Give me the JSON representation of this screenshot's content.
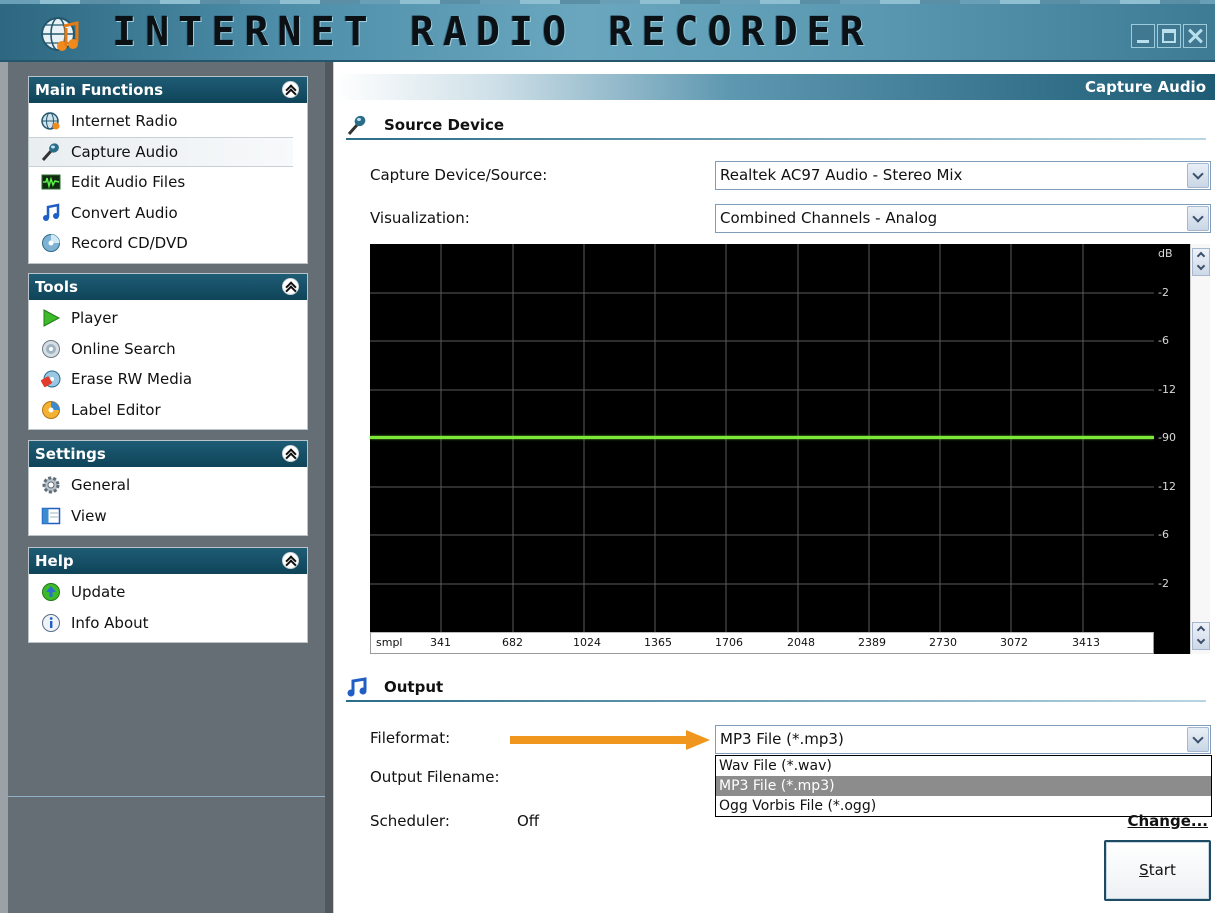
{
  "app": {
    "title": "INTERNET RADIO RECORDER"
  },
  "sidebar": {
    "panels": [
      {
        "title": "Main Functions",
        "items": [
          {
            "label": "Internet Radio",
            "icon": "radio-globe-icon"
          },
          {
            "label": "Capture Audio",
            "icon": "microphone-icon",
            "selected": true
          },
          {
            "label": "Edit Audio Files",
            "icon": "waveform-icon"
          },
          {
            "label": "Convert Audio",
            "icon": "music-notes-icon"
          },
          {
            "label": "Record CD/DVD",
            "icon": "cd-icon"
          }
        ]
      },
      {
        "title": "Tools",
        "items": [
          {
            "label": "Player",
            "icon": "play-icon"
          },
          {
            "label": "Online Search",
            "icon": "search-disc-icon"
          },
          {
            "label": "Erase RW Media",
            "icon": "erase-disc-icon"
          },
          {
            "label": "Label Editor",
            "icon": "label-disc-icon"
          }
        ]
      },
      {
        "title": "Settings",
        "items": [
          {
            "label": "General",
            "icon": "gear-icon"
          },
          {
            "label": "View",
            "icon": "view-icon"
          }
        ]
      },
      {
        "title": "Help",
        "items": [
          {
            "label": "Update",
            "icon": "update-icon"
          },
          {
            "label": "Info About",
            "icon": "info-icon"
          }
        ]
      }
    ]
  },
  "main": {
    "page_title": "Capture Audio",
    "source_section": {
      "title": "Source Device",
      "capture_label": "Capture Device/Source:",
      "capture_value": "Realtek AC97 Audio - Stereo Mix",
      "visualization_label": "Visualization:",
      "visualization_value": "Combined Channels - Analog"
    },
    "visualizer": {
      "scale_unit": "dB",
      "scale_ticks": [
        "-2",
        "-6",
        "-12",
        "-90",
        "-12",
        "-6",
        "-2"
      ],
      "x_label": "smpl",
      "x_ticks": [
        "341",
        "682",
        "1024",
        "1365",
        "1706",
        "2048",
        "2389",
        "2730",
        "3072",
        "3413"
      ],
      "signal_color": "#7ee83a"
    },
    "output_section": {
      "title": "Output",
      "fileformat_label": "Fileformat:",
      "fileformat_value": "MP3 File (*.mp3)",
      "fileformat_options": [
        "Wav File (*.wav)",
        "MP3 File (*.mp3)",
        "Ogg Vorbis File (*.ogg)"
      ],
      "fileformat_selected_index": 1,
      "output_filename_label": "Output Filename:",
      "scheduler_label": "Scheduler:",
      "scheduler_value": "Off",
      "change_label": "Change..."
    },
    "start_button": {
      "label": "Start",
      "mnemonic": "S",
      "rest": "tart"
    }
  },
  "colors": {
    "header_dark": "#0f4459",
    "sidebar_bg": "#656e74",
    "arrow": "#f0961e",
    "signal": "#7ee83a"
  }
}
